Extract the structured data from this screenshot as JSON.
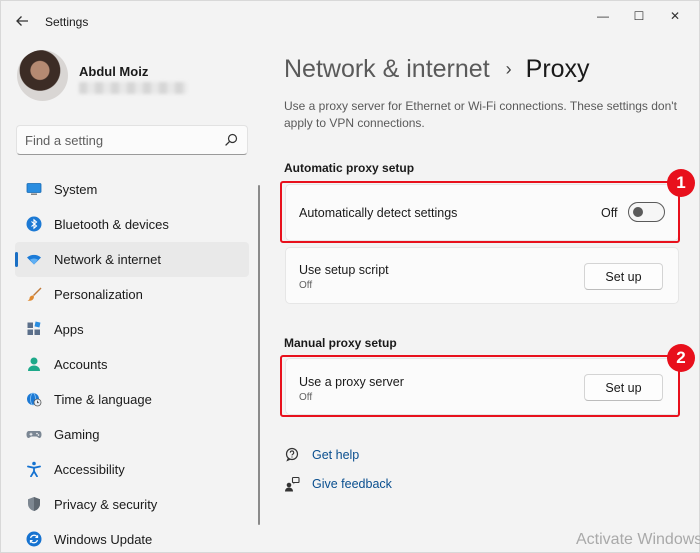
{
  "window": {
    "title": "Settings",
    "back_icon": "arrow-left-icon",
    "controls": {
      "minimize": "—",
      "maximize": "☐",
      "close": "✕"
    }
  },
  "profile": {
    "name": "Abdul Moiz",
    "email_redacted": true
  },
  "search": {
    "placeholder": "Find a setting",
    "icon": "search-icon"
  },
  "sidebar": {
    "items": [
      {
        "label": "System",
        "icon": "monitor-icon",
        "active": false
      },
      {
        "label": "Bluetooth & devices",
        "icon": "bluetooth-icon",
        "active": false
      },
      {
        "label": "Network & internet",
        "icon": "wifi-icon",
        "active": true
      },
      {
        "label": "Personalization",
        "icon": "brush-icon",
        "active": false
      },
      {
        "label": "Apps",
        "icon": "apps-icon",
        "active": false
      },
      {
        "label": "Accounts",
        "icon": "person-icon",
        "active": false
      },
      {
        "label": "Time & language",
        "icon": "globe-clock-icon",
        "active": false
      },
      {
        "label": "Gaming",
        "icon": "gamepad-icon",
        "active": false
      },
      {
        "label": "Accessibility",
        "icon": "accessibility-icon",
        "active": false
      },
      {
        "label": "Privacy & security",
        "icon": "shield-icon",
        "active": false
      },
      {
        "label": "Windows Update",
        "icon": "update-icon",
        "active": false
      }
    ]
  },
  "breadcrumb": {
    "parent": "Network & internet",
    "separator": "›",
    "current": "Proxy"
  },
  "description": "Use a proxy server for Ethernet or Wi-Fi connections. These settings don't apply to VPN connections.",
  "automatic": {
    "title": "Automatic proxy setup",
    "detect": {
      "label": "Automatically detect settings",
      "state_text": "Off",
      "on": false
    },
    "script": {
      "label": "Use setup script",
      "sub": "Off",
      "button": "Set up"
    }
  },
  "manual": {
    "title": "Manual proxy setup",
    "proxy": {
      "label": "Use a proxy server",
      "sub": "Off",
      "button": "Set up"
    }
  },
  "help": {
    "get_help": "Get help",
    "give_feedback": "Give feedback"
  },
  "annotations": {
    "marker1": "1",
    "marker2": "2",
    "color": "#e8101c"
  },
  "accent_color": "#1a6fc4",
  "watermark": "Activate Windows"
}
